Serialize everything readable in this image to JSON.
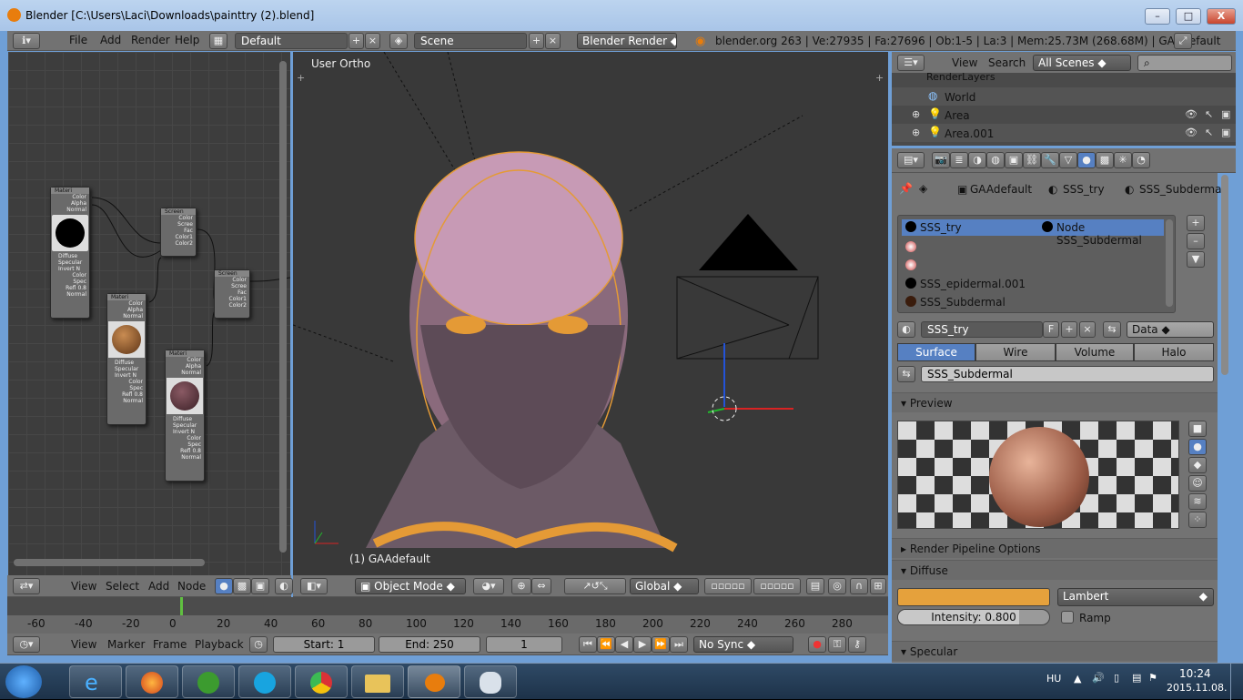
{
  "window": {
    "title": "Blender [C:\\Users\\Laci\\Downloads\\painttry (2).blend]",
    "min": "–",
    "max": "□",
    "close": "X"
  },
  "topmenu": {
    "file": "File",
    "add": "Add",
    "render": "Render",
    "help": "Help",
    "layout": "Default",
    "scene": "Scene",
    "engine": "Blender Render",
    "stats": "blender.org 263 | Ve:27935 | Fa:27696 | Ob:1-5 | La:3 | Mem:25.73M (268.68M) | GAAdefault"
  },
  "nodes": [
    {
      "header": "Materi",
      "lines": [
        "Color",
        "Alpha",
        "Normal"
      ],
      "footer": [
        "Diffuse",
        "Specular",
        "Invert N",
        "Color",
        "Spec",
        "Refl 0.8",
        "Normal"
      ]
    },
    {
      "header": "Screen",
      "lines": [
        "Color",
        "Scree",
        "Fac",
        "Color1",
        "Color2"
      ]
    },
    {
      "header": "Materi",
      "lines": [
        "Color",
        "Alpha",
        "Normal"
      ],
      "footer": [
        "Diffuse",
        "Specular",
        "Invert N",
        "Color",
        "Spec",
        "Refl 0.8",
        "Normal"
      ]
    },
    {
      "header": "Screen",
      "lines": [
        "Color",
        "Scree",
        "Fac",
        "Color1",
        "Color2"
      ]
    },
    {
      "header": "Materi",
      "lines": [
        "Color",
        "Alpha",
        "Normal"
      ],
      "footer": [
        "Diffuse",
        "Specular",
        "Invert N",
        "Color",
        "Spec",
        "Refl 0.8",
        "Normal"
      ]
    }
  ],
  "nodebar": {
    "view": "View",
    "select": "Select",
    "add": "Add",
    "node": "Node"
  },
  "viewport": {
    "label": "User Ortho",
    "object": "(1) GAAdefault",
    "mode": "Object Mode",
    "orientation": "Global"
  },
  "outliner": {
    "view": "View",
    "search": "Search",
    "filter": "All Scenes",
    "items": [
      "RenderLayers",
      "World",
      "Area",
      "Area.001"
    ]
  },
  "breadcrumb": {
    "object": "GAAdefault",
    "material": "SSS_try",
    "node": "SSS_Subdermal"
  },
  "matlist": {
    "slots": [
      "SSS_try",
      "",
      "",
      "SSS_epidermal.001",
      "SSS_Subdermal"
    ],
    "node_label": "Node SSS_Subdermal",
    "add": "+",
    "remove": "–",
    "move": "▼"
  },
  "material": {
    "name": "SSS_try",
    "fake": "F",
    "browse": "Data",
    "tabs": [
      "Surface",
      "Wire",
      "Volume",
      "Halo"
    ],
    "subname": "SSS_Subdermal"
  },
  "preview": {
    "header": "Preview"
  },
  "panels": {
    "pipeline": "Render Pipeline Options",
    "diffuse": "Diffuse",
    "shader": "Lambert",
    "intensity": "Intensity: 0.800",
    "intensity_value": 0.8,
    "ramp": "Ramp",
    "specular": "Specular",
    "diffuse_color": "#e5a13c"
  },
  "timeline": {
    "ticks": [
      "-60",
      "-40",
      "-20",
      "0",
      "20",
      "40",
      "60",
      "80",
      "100",
      "120",
      "140",
      "160",
      "180",
      "200",
      "220",
      "240",
      "260",
      "280"
    ],
    "view": "View",
    "marker": "Marker",
    "frame": "Frame",
    "playback": "Playback",
    "start": "Start: 1",
    "end": "End: 250",
    "current": "1",
    "sync": "No Sync"
  },
  "tray": {
    "lang": "HU",
    "time": "10:24",
    "date": "2015.11.08."
  }
}
